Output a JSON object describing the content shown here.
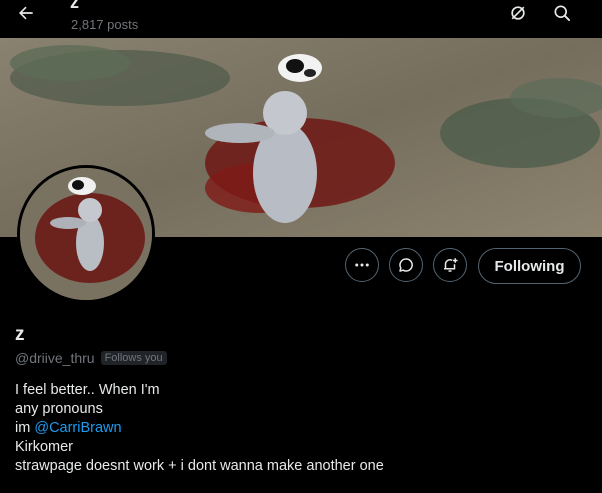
{
  "header": {
    "title": "z",
    "post_count": "2,817 posts"
  },
  "profile": {
    "name": "z",
    "handle": "@driive_thru",
    "follows_you": "Follows you",
    "bio": {
      "line1": "I feel better.. When I'm",
      "line2": "any pronouns",
      "line3_prefix": "im ",
      "line3_mention": "@CarriBrawn",
      "line4": "Kirkomer",
      "line5": "strawpage doesnt work + i dont wanna make another one"
    }
  },
  "actions": {
    "following_label": "Following"
  },
  "colors": {
    "background": "#000000",
    "accent": "#1d9bf0",
    "muted": "#71767b",
    "border": "#536471"
  }
}
